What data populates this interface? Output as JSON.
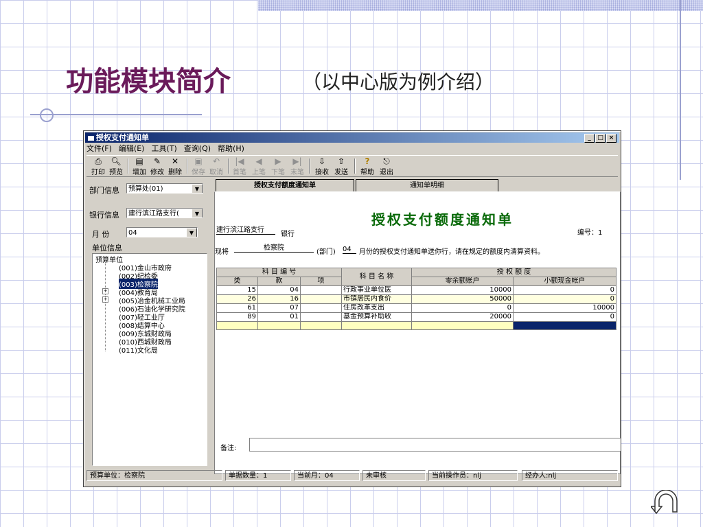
{
  "slide": {
    "title": "功能模块简介",
    "subtitle": "（以中心版为例介绍）"
  },
  "window": {
    "title": "授权支付通知单",
    "controls": [
      "_",
      "□",
      "×"
    ]
  },
  "menu": [
    "文件(F)",
    "编辑(E)",
    "工具(T)",
    "查询(Q)",
    "帮助(H)"
  ],
  "toolbar": {
    "print": "打印",
    "preview": "预览",
    "add": "增加",
    "edit": "修改",
    "delete": "删除",
    "save": "保存",
    "cancel": "取消",
    "first": "首笔",
    "prev": "上笔",
    "next": "下笔",
    "last": "末笔",
    "receive": "接收",
    "send": "发送",
    "help": "帮助",
    "exit": "退出"
  },
  "left": {
    "dept_label": "部门信息",
    "dept_value": "预算处(01)",
    "bank_label": "银行信息",
    "bank_value": "建行滨江路支行(",
    "month_label": "月  份",
    "month_value": "04",
    "unit_label": "单位信息",
    "tree_root": "预算单位",
    "tree_items": [
      "(001)金山市政府",
      "(002)纪检委",
      "(003)检察院",
      "(004)教育局",
      "(005)冶金机械工业局",
      "(006)石油化学研究院",
      "(007)轻工业厅",
      "(008)结算中心",
      "(009)东城财政局",
      "(010)西城财政局",
      "(011)文化局"
    ]
  },
  "tabs": [
    "授权支付额度通知单",
    "通知单明细"
  ],
  "form": {
    "title": "授权支付额度通知单",
    "bank_name": "建行滨江路支行",
    "bank_suffix": "银行",
    "number": "编号：1",
    "line_prefix": "现将",
    "dept": "检察院",
    "dept_suffix": "(部门)",
    "month": "04",
    "line_text": "月份的授权支付通知单送你行，请在规定的额度内清算资料。",
    "header": {
      "subject_code": "科 目 编 号",
      "class": "类",
      "item": "款",
      "sub": "项",
      "subject_name": "科 目 名 称",
      "quota": "授 权 额 度",
      "zero_balance": "零余额账户",
      "small_cash": "小额现金帐户"
    },
    "rows": [
      {
        "class": "15",
        "item": "04",
        "sub": "",
        "name": "行政事业单位医",
        "zero": "10000",
        "cash": "0"
      },
      {
        "class": "26",
        "item": "16",
        "sub": "",
        "name": "市镇居民内食价",
        "zero": "50000",
        "cash": "0"
      },
      {
        "class": "61",
        "item": "07",
        "sub": "",
        "name": "住房改革支出",
        "zero": "0",
        "cash": "10000"
      },
      {
        "class": "89",
        "item": "01",
        "sub": "",
        "name": "基金预算补助收",
        "zero": "20000",
        "cash": "0"
      }
    ],
    "memo_label": "备注:"
  },
  "status": {
    "unit": "预算单位：检察院",
    "count": "单据数量：1",
    "month": "当前月：04",
    "audit": "未审核",
    "operator": "当前操作员：nlj",
    "handler": "经办人:nlj"
  },
  "colors": {
    "title": "#6a1a5a",
    "form_title": "#0a6a0a",
    "titlebar": "#0a246a"
  }
}
